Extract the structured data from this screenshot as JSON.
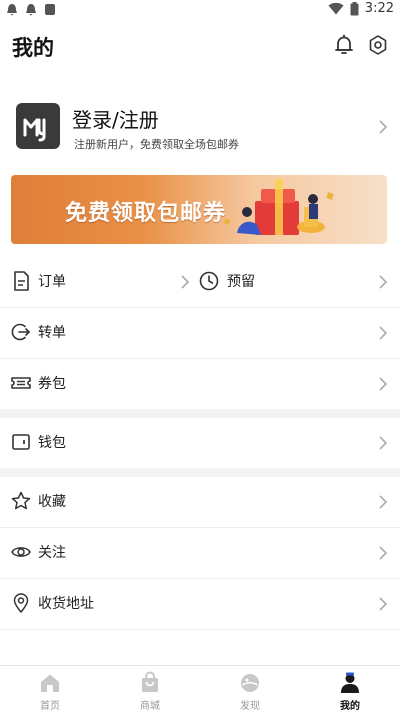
{
  "status_bar": {
    "time": "3:22"
  },
  "header": {
    "title": "我的"
  },
  "account": {
    "title": "登录/注册",
    "subtitle": "注册新用户，免费领取全场包邮券"
  },
  "banner": {
    "text": "免费领取包邮券"
  },
  "menu": {
    "order": "订单",
    "reserve": "预留",
    "transfer": "转单",
    "coupons": "券包",
    "wallet": "钱包",
    "favorites": "收藏",
    "follow": "关注",
    "address": "收货地址"
  },
  "tabs": [
    {
      "label": "首页",
      "icon": "home-icon",
      "active": false
    },
    {
      "label": "商城",
      "icon": "shopping-bag-icon",
      "active": false
    },
    {
      "label": "发现",
      "icon": "planet-icon",
      "active": false
    },
    {
      "label": "我的",
      "icon": "user-icon",
      "active": true
    }
  ],
  "colors": {
    "banner_start": "#df7e3a",
    "banner_end": "#f7dfc8",
    "text": "#222222",
    "inactive_tab": "#9a9a9a"
  }
}
